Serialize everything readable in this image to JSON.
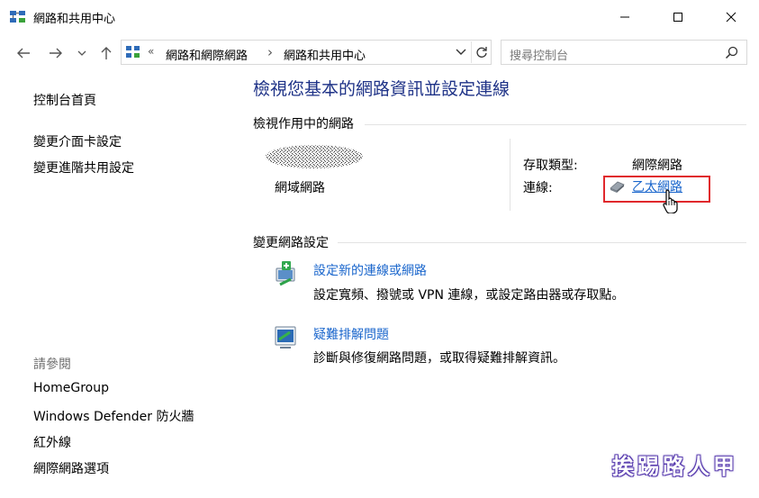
{
  "window": {
    "title": "網路和共用中心",
    "controls": [
      "minimize",
      "maximize",
      "close"
    ]
  },
  "address_bar": {
    "overflow": "«",
    "breadcrumbs": [
      "網路和網際網路",
      "網路和共用中心"
    ],
    "separator": "›",
    "search_placeholder": "搜尋控制台"
  },
  "sidebar": {
    "links": [
      "控制台首頁",
      "變更介面卡設定",
      "變更進階共用設定"
    ],
    "see_also_heading": "請參閱",
    "see_also": [
      "HomeGroup",
      "Windows Defender 防火牆",
      "紅外線",
      "網際網路選項"
    ]
  },
  "main": {
    "title": "檢視您基本的網路資訊並設定連線",
    "active_networks": {
      "heading": "檢視作用中的網路",
      "network_type": "網域網路",
      "access_type_label": "存取類型:",
      "access_type_value": "網際網路",
      "connections_label": "連線:",
      "connection_name": "乙太網路"
    },
    "change_settings": {
      "heading": "變更網路設定",
      "tasks": [
        {
          "title": "設定新的連線或網路",
          "description": "設定寬頻、撥號或 VPN 連線，或設定路由器或存取點。"
        },
        {
          "title": "疑難排解問題",
          "description": "診斷與修復網路問題，或取得疑難排解資訊。"
        }
      ]
    }
  },
  "watermark": "挨踢路人甲",
  "colors": {
    "title_blue": "#1e3287",
    "link_blue": "#1a66cc",
    "highlight_red": "#e0282c",
    "divider": "#e3e3e3",
    "watermark_outline": "#5b3fb0"
  }
}
